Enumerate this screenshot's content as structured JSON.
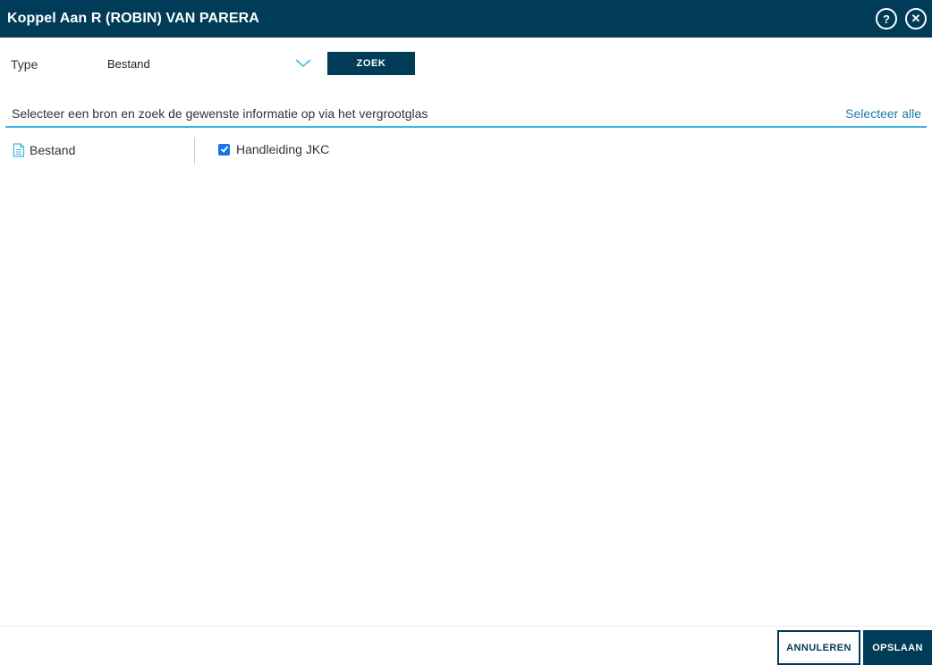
{
  "dialog": {
    "title": "Koppel Aan R (ROBIN) VAN PARERA",
    "help_icon": "question-icon",
    "close_icon": "close-icon"
  },
  "search": {
    "type_label": "Type",
    "type_value": "Bestand",
    "search_button": "ZOEK"
  },
  "info": {
    "instruction": "Selecteer een bron en zoek de gewenste informatie op via het vergrootglas",
    "select_all": "Selecteer alle"
  },
  "sources": [
    {
      "label": "Bestand",
      "icon": "document-icon"
    }
  ],
  "results": [
    {
      "label": "Handleiding JKC",
      "checked": true
    }
  ],
  "footer": {
    "cancel": "ANNULEREN",
    "save": "OPSLAAN"
  },
  "colors": {
    "primary": "#003c58",
    "accent": "#3cb6de",
    "link": "#1e7ea8",
    "checkbox": "#1a73e8"
  }
}
